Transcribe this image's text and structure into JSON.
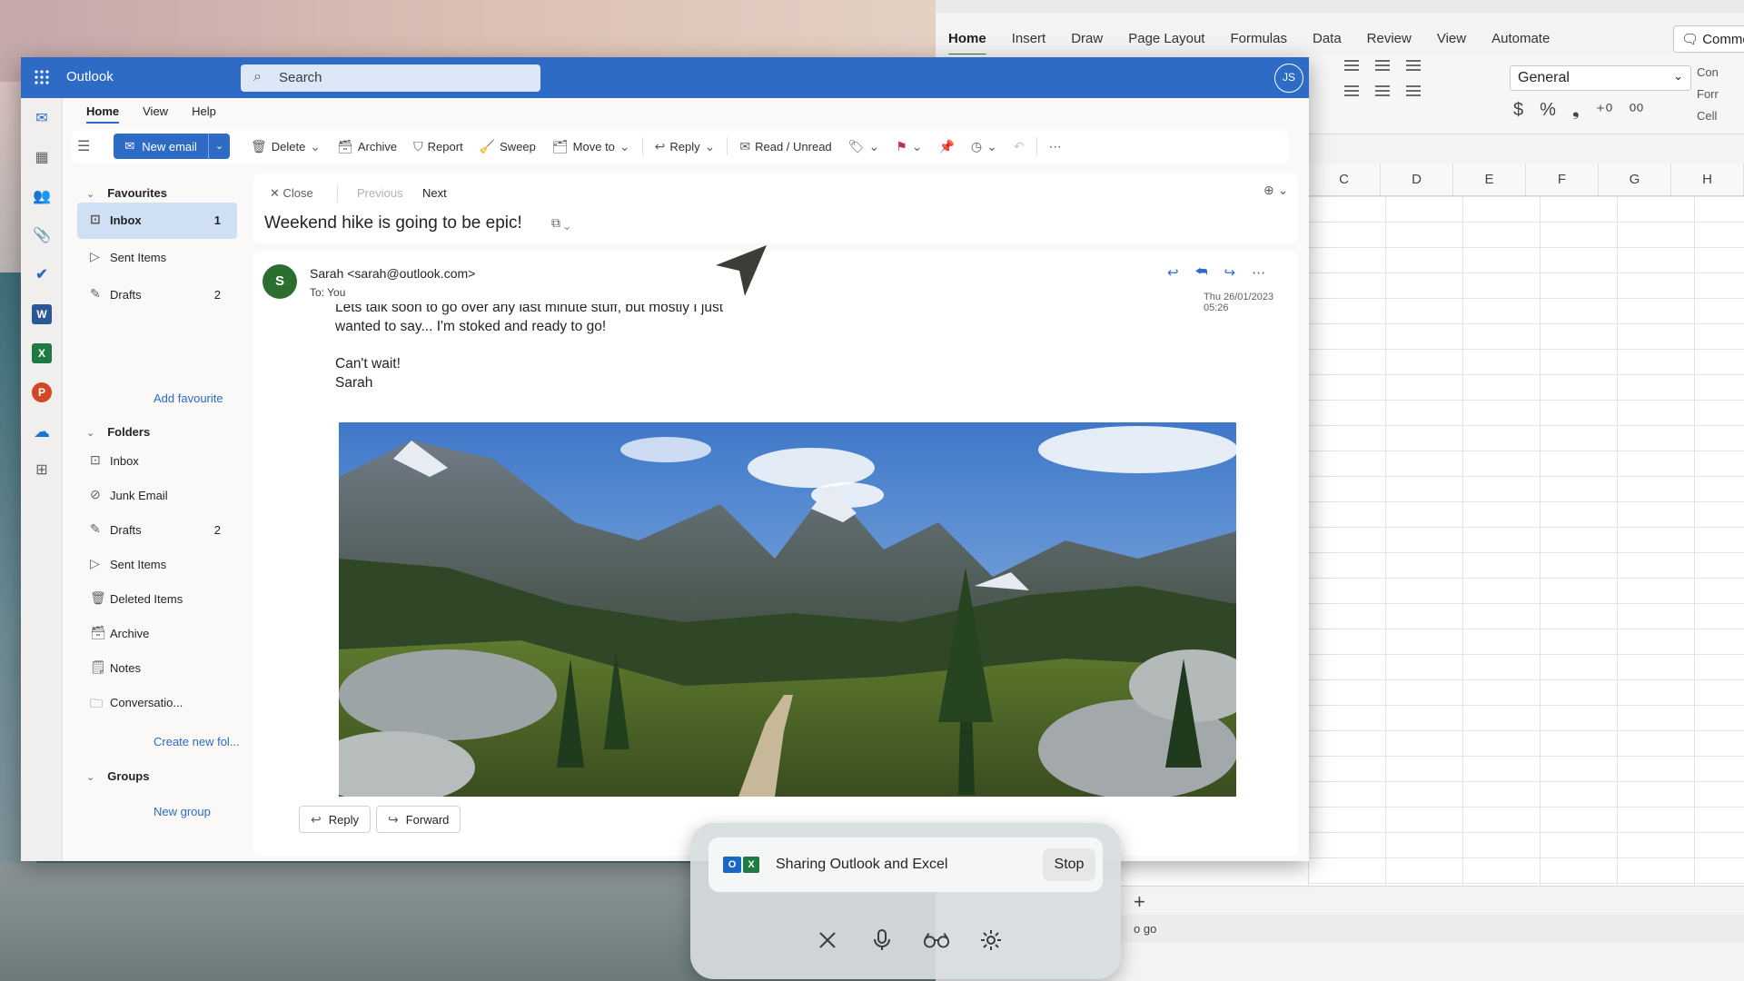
{
  "excel": {
    "tabs": [
      "Home",
      "Insert",
      "Draw",
      "Page Layout",
      "Formulas",
      "Data",
      "Review",
      "View",
      "Automate"
    ],
    "comments_label": "Comme",
    "number_format": "General",
    "styles": [
      "Con",
      "Forr",
      "Cell"
    ],
    "columns": [
      "C",
      "D",
      "E",
      "F",
      "G",
      "H"
    ],
    "status_text": "o go"
  },
  "outlook": {
    "app_name": "Outlook",
    "search_placeholder": "Search",
    "avatar_initials": "JS",
    "menu_tabs": [
      "Home",
      "View",
      "Help"
    ],
    "toolbar": {
      "new_email": "New email",
      "delete": "Delete",
      "archive": "Archive",
      "report": "Report",
      "sweep": "Sweep",
      "move_to": "Move to",
      "reply": "Reply",
      "read_unread": "Read / Unread"
    },
    "favourites": {
      "header": "Favourites",
      "items": [
        {
          "label": "Inbox",
          "count": "1"
        },
        {
          "label": "Sent Items",
          "count": ""
        },
        {
          "label": "Drafts",
          "count": "2"
        }
      ],
      "add_link": "Add favourite"
    },
    "folders": {
      "header": "Folders",
      "items": [
        {
          "label": "Inbox",
          "count": ""
        },
        {
          "label": "Junk Email",
          "count": ""
        },
        {
          "label": "Drafts",
          "count": "2"
        },
        {
          "label": "Sent Items",
          "count": ""
        },
        {
          "label": "Deleted Items",
          "count": ""
        },
        {
          "label": "Archive",
          "count": ""
        },
        {
          "label": "Notes",
          "count": ""
        },
        {
          "label": "Conversatio...",
          "count": ""
        }
      ],
      "create_link": "Create new fol..."
    },
    "groups": {
      "header": "Groups",
      "new_link": "New group"
    },
    "reading": {
      "close": "Close",
      "previous": "Previous",
      "next": "Next",
      "subject": "Weekend hike is going to be epic!",
      "sender_initial": "S",
      "from": "Sarah <sarah@outlook.com>",
      "to": "To:  You",
      "date": "Thu 26/01/2023 05:26",
      "body_cut": "Lets talk soon to go over any last minute stuff, but mostly I just",
      "body_line": "wanted to say... I'm stoked and ready to go!",
      "sign_off": "Can't wait!",
      "signature": "Sarah",
      "footer_reply": "Reply",
      "footer_forward": "Forward"
    }
  },
  "share": {
    "label": "Sharing Outlook and Excel",
    "stop": "Stop"
  }
}
